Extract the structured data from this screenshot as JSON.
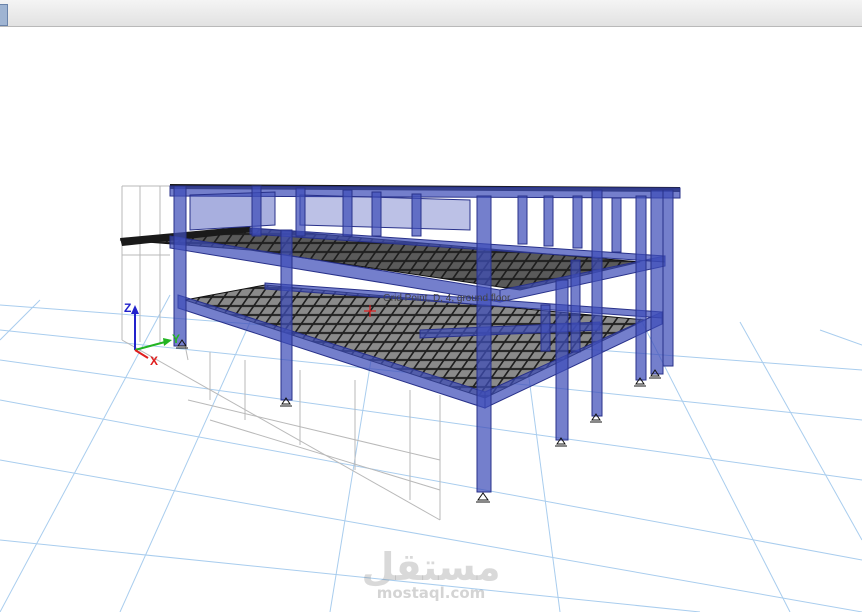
{
  "window": {
    "title": ""
  },
  "viewport": {
    "point_label": "Grid Point, D, 4, ground floor",
    "axes": {
      "x": "X",
      "y": "Y",
      "z": "Z"
    },
    "colors": {
      "frame": "#3f4db8",
      "grid": "#9fc6ea",
      "slab": "#2b2b2b",
      "x_axis": "#e01c1c",
      "y_axis": "#22b422",
      "z_axis": "#2222cc"
    },
    "icons": [
      "support-icon",
      "axis-triad-icon",
      "crosshair-icon"
    ]
  },
  "watermark": {
    "text": "مستقل",
    "url": "mostaql.com"
  }
}
